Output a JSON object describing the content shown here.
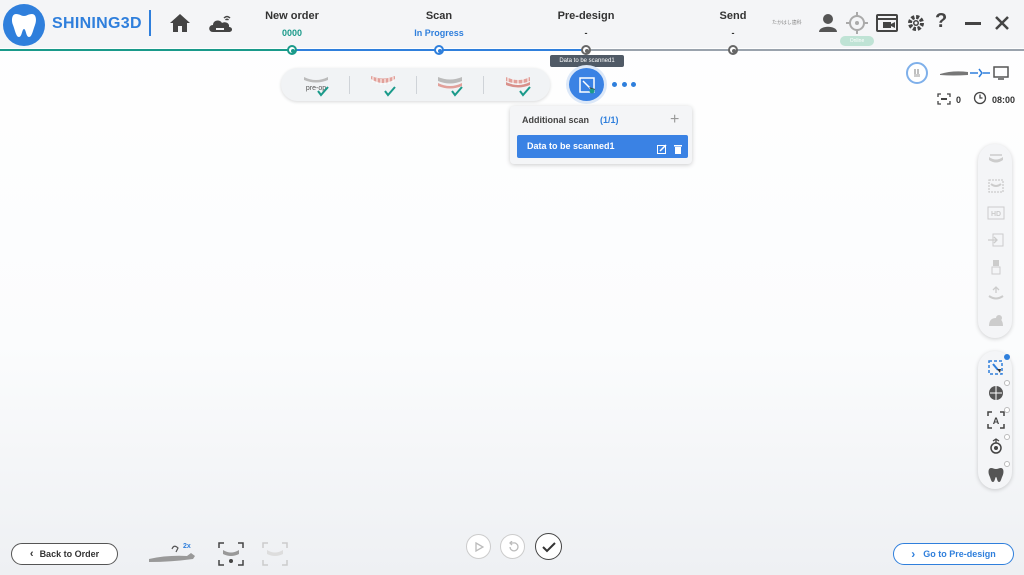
{
  "app": {
    "brand": "SHINING3D"
  },
  "header": {
    "steps": [
      {
        "label": "New order",
        "sub": "0000"
      },
      {
        "label": "Scan",
        "sub": "In Progress"
      },
      {
        "label": "Pre-design",
        "sub": "-"
      },
      {
        "label": "Send",
        "sub": "-"
      }
    ],
    "clinic": "たかはし歯科",
    "status_badge": "Online"
  },
  "toolbar": {
    "jaws": [
      "pre-op",
      "upper",
      "lower",
      "bite"
    ],
    "tooltip": "Data to be scanned1"
  },
  "dropdown": {
    "title": "Additional scan",
    "count": "(1/1)",
    "item": "Data to be scanned1"
  },
  "status": {
    "scan_count": "0",
    "timer": "08:00"
  },
  "bottom": {
    "back_label": "Back to Order",
    "next_label": "Go to Pre-design",
    "tip_badge": "2x"
  },
  "colors": {
    "accent": "#2f7fdc",
    "active_fill": "#3a82e4",
    "done": "#1a9a8a"
  }
}
